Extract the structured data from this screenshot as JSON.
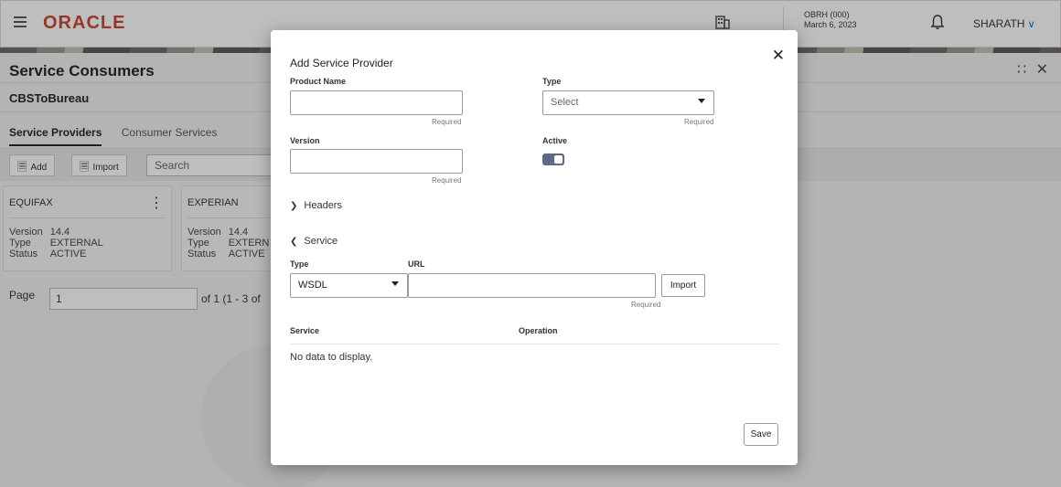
{
  "header": {
    "logo": "ORACLE",
    "branch_code": "OBRH (000)",
    "branch_date": "March 6, 2023",
    "user": "SHARATH"
  },
  "page": {
    "title": "Service Consumers",
    "consumer": "CBSToBureau",
    "tabs": [
      {
        "label": "Service Providers",
        "active": true
      },
      {
        "label": "Consumer Services",
        "active": false
      }
    ],
    "toolbar": {
      "add_label": "Add",
      "import_label": "Import",
      "search_placeholder": "Search"
    },
    "cards": [
      {
        "name": "EQUIFAX",
        "version_label": "Version",
        "version": "14.4",
        "type_label": "Type",
        "type": "EXTERNAL",
        "status_label": "Status",
        "status": "ACTIVE"
      },
      {
        "name": "EXPERIAN",
        "version_label": "Version",
        "version": "14.4",
        "type_label": "Type",
        "type": "EXTERN",
        "status_label": "Status",
        "status": "ACTIVE"
      }
    ],
    "pager": {
      "page_label": "Page",
      "page_value": "1",
      "of_text": "of 1  (1 - 3 of"
    }
  },
  "dialog": {
    "title": "Add Service Provider",
    "product_name_label": "Product Name",
    "product_name_value": "",
    "type_label": "Type",
    "type_placeholder": "Select",
    "version_label": "Version",
    "version_value": "",
    "active_label": "Active",
    "active": true,
    "required_text": "Required",
    "headers_section": "Headers",
    "service_section": "Service",
    "service_type_label": "Type",
    "service_type_value": "WSDL",
    "url_label": "URL",
    "url_value": "",
    "import_label": "Import",
    "table_headers": [
      "Service",
      "Operation"
    ],
    "no_data": "No data to display.",
    "save_label": "Save"
  },
  "colors": {
    "brand": "#c74634",
    "accent": "#0572ce",
    "toggle": "#5b6b85"
  }
}
